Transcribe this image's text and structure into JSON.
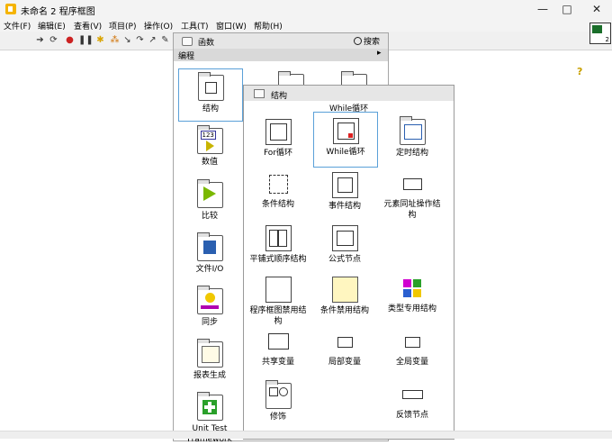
{
  "window": {
    "title": "未命名 2 程序框图",
    "min_glyph": "—",
    "max_glyph": "□",
    "close_glyph": "✕"
  },
  "menubar": {
    "items": [
      "文件(F)",
      "编辑(E)",
      "查看(V)",
      "项目(P)",
      "操作(O)",
      "工具(T)",
      "窗口(W)",
      "帮助(H)"
    ]
  },
  "toolbar": {
    "help_glyph": "?",
    "vi_icon_number": "2"
  },
  "palette": {
    "title": "函数",
    "search_label": "搜索",
    "category": "编程",
    "category_arrow": "▸",
    "items": [
      {
        "label": "结构",
        "icon": "structures-icon"
      },
      {
        "label": "数值",
        "icon": "numeric-icon"
      },
      {
        "label": "比较",
        "icon": "comparison-icon"
      },
      {
        "label": "文件I/O",
        "icon": "file-io-icon"
      },
      {
        "label": "同步",
        "icon": "synchronization-icon"
      },
      {
        "label": "报表生成",
        "icon": "report-generation-icon"
      },
      {
        "label": "Unit Test Framework",
        "icon": "unit-test-framework-icon"
      }
    ]
  },
  "subpalette": {
    "title": "结构",
    "tooltip": "While循环",
    "items": [
      {
        "label": "For循环",
        "icon": "for-loop-icon"
      },
      {
        "label": "While循环",
        "icon": "while-loop-icon"
      },
      {
        "label": "定时结构",
        "icon": "timed-structure-icon"
      },
      {
        "label": "条件结构",
        "icon": "case-structure-icon"
      },
      {
        "label": "事件结构",
        "icon": "event-structure-icon"
      },
      {
        "label": "元素同址操作结构",
        "icon": "in-place-element-structure-icon"
      },
      {
        "label": "平铺式顺序结构",
        "icon": "flat-sequence-icon"
      },
      {
        "label": "公式节点",
        "icon": "formula-node-icon"
      },
      {
        "label": "",
        "icon": "blank"
      },
      {
        "label": "程序框图禁用结构",
        "icon": "diagram-disable-structure-icon"
      },
      {
        "label": "条件禁用结构",
        "icon": "conditional-disable-structure-icon"
      },
      {
        "label": "类型专用结构",
        "icon": "type-specialization-structure-icon"
      },
      {
        "label": "共享变量",
        "icon": "shared-variable-icon"
      },
      {
        "label": "局部变量",
        "icon": "local-variable-icon"
      },
      {
        "label": "全局变量",
        "icon": "global-variable-icon"
      },
      {
        "label": "修饰",
        "icon": "decorations-icon"
      },
      {
        "label": "",
        "icon": "blank"
      },
      {
        "label": "反馈节点",
        "icon": "feedback-node-icon"
      }
    ]
  }
}
